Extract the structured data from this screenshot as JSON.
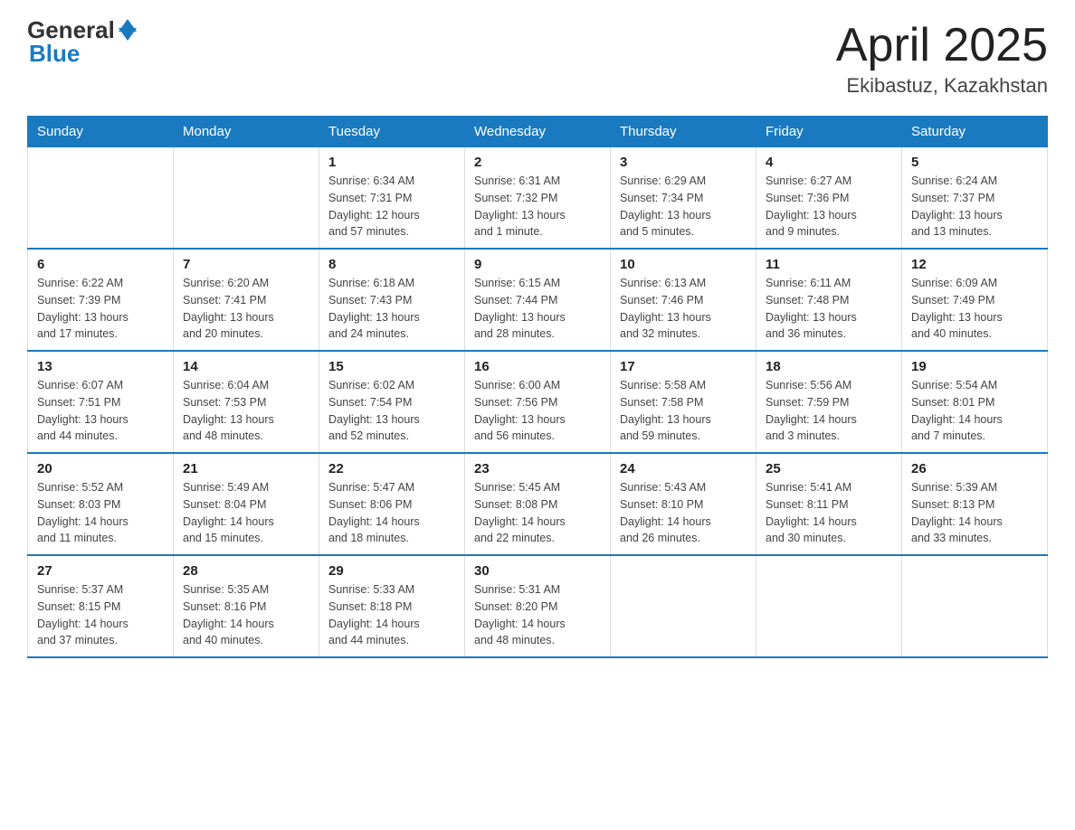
{
  "header": {
    "logo_general": "General",
    "logo_blue": "Blue",
    "month_title": "April 2025",
    "location": "Ekibastuz, Kazakhstan"
  },
  "days_of_week": [
    "Sunday",
    "Monday",
    "Tuesday",
    "Wednesday",
    "Thursday",
    "Friday",
    "Saturday"
  ],
  "weeks": [
    [
      {
        "day": "",
        "info": ""
      },
      {
        "day": "",
        "info": ""
      },
      {
        "day": "1",
        "info": "Sunrise: 6:34 AM\nSunset: 7:31 PM\nDaylight: 12 hours\nand 57 minutes."
      },
      {
        "day": "2",
        "info": "Sunrise: 6:31 AM\nSunset: 7:32 PM\nDaylight: 13 hours\nand 1 minute."
      },
      {
        "day": "3",
        "info": "Sunrise: 6:29 AM\nSunset: 7:34 PM\nDaylight: 13 hours\nand 5 minutes."
      },
      {
        "day": "4",
        "info": "Sunrise: 6:27 AM\nSunset: 7:36 PM\nDaylight: 13 hours\nand 9 minutes."
      },
      {
        "day": "5",
        "info": "Sunrise: 6:24 AM\nSunset: 7:37 PM\nDaylight: 13 hours\nand 13 minutes."
      }
    ],
    [
      {
        "day": "6",
        "info": "Sunrise: 6:22 AM\nSunset: 7:39 PM\nDaylight: 13 hours\nand 17 minutes."
      },
      {
        "day": "7",
        "info": "Sunrise: 6:20 AM\nSunset: 7:41 PM\nDaylight: 13 hours\nand 20 minutes."
      },
      {
        "day": "8",
        "info": "Sunrise: 6:18 AM\nSunset: 7:43 PM\nDaylight: 13 hours\nand 24 minutes."
      },
      {
        "day": "9",
        "info": "Sunrise: 6:15 AM\nSunset: 7:44 PM\nDaylight: 13 hours\nand 28 minutes."
      },
      {
        "day": "10",
        "info": "Sunrise: 6:13 AM\nSunset: 7:46 PM\nDaylight: 13 hours\nand 32 minutes."
      },
      {
        "day": "11",
        "info": "Sunrise: 6:11 AM\nSunset: 7:48 PM\nDaylight: 13 hours\nand 36 minutes."
      },
      {
        "day": "12",
        "info": "Sunrise: 6:09 AM\nSunset: 7:49 PM\nDaylight: 13 hours\nand 40 minutes."
      }
    ],
    [
      {
        "day": "13",
        "info": "Sunrise: 6:07 AM\nSunset: 7:51 PM\nDaylight: 13 hours\nand 44 minutes."
      },
      {
        "day": "14",
        "info": "Sunrise: 6:04 AM\nSunset: 7:53 PM\nDaylight: 13 hours\nand 48 minutes."
      },
      {
        "day": "15",
        "info": "Sunrise: 6:02 AM\nSunset: 7:54 PM\nDaylight: 13 hours\nand 52 minutes."
      },
      {
        "day": "16",
        "info": "Sunrise: 6:00 AM\nSunset: 7:56 PM\nDaylight: 13 hours\nand 56 minutes."
      },
      {
        "day": "17",
        "info": "Sunrise: 5:58 AM\nSunset: 7:58 PM\nDaylight: 13 hours\nand 59 minutes."
      },
      {
        "day": "18",
        "info": "Sunrise: 5:56 AM\nSunset: 7:59 PM\nDaylight: 14 hours\nand 3 minutes."
      },
      {
        "day": "19",
        "info": "Sunrise: 5:54 AM\nSunset: 8:01 PM\nDaylight: 14 hours\nand 7 minutes."
      }
    ],
    [
      {
        "day": "20",
        "info": "Sunrise: 5:52 AM\nSunset: 8:03 PM\nDaylight: 14 hours\nand 11 minutes."
      },
      {
        "day": "21",
        "info": "Sunrise: 5:49 AM\nSunset: 8:04 PM\nDaylight: 14 hours\nand 15 minutes."
      },
      {
        "day": "22",
        "info": "Sunrise: 5:47 AM\nSunset: 8:06 PM\nDaylight: 14 hours\nand 18 minutes."
      },
      {
        "day": "23",
        "info": "Sunrise: 5:45 AM\nSunset: 8:08 PM\nDaylight: 14 hours\nand 22 minutes."
      },
      {
        "day": "24",
        "info": "Sunrise: 5:43 AM\nSunset: 8:10 PM\nDaylight: 14 hours\nand 26 minutes."
      },
      {
        "day": "25",
        "info": "Sunrise: 5:41 AM\nSunset: 8:11 PM\nDaylight: 14 hours\nand 30 minutes."
      },
      {
        "day": "26",
        "info": "Sunrise: 5:39 AM\nSunset: 8:13 PM\nDaylight: 14 hours\nand 33 minutes."
      }
    ],
    [
      {
        "day": "27",
        "info": "Sunrise: 5:37 AM\nSunset: 8:15 PM\nDaylight: 14 hours\nand 37 minutes."
      },
      {
        "day": "28",
        "info": "Sunrise: 5:35 AM\nSunset: 8:16 PM\nDaylight: 14 hours\nand 40 minutes."
      },
      {
        "day": "29",
        "info": "Sunrise: 5:33 AM\nSunset: 8:18 PM\nDaylight: 14 hours\nand 44 minutes."
      },
      {
        "day": "30",
        "info": "Sunrise: 5:31 AM\nSunset: 8:20 PM\nDaylight: 14 hours\nand 48 minutes."
      },
      {
        "day": "",
        "info": ""
      },
      {
        "day": "",
        "info": ""
      },
      {
        "day": "",
        "info": ""
      }
    ]
  ]
}
